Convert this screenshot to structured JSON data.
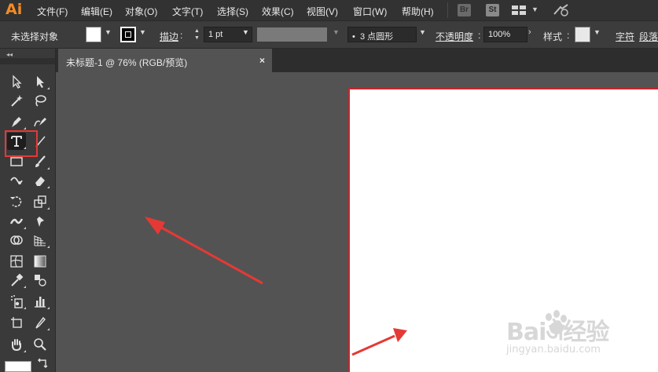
{
  "app": {
    "logo": "Ai"
  },
  "menubar": {
    "items": [
      "文件(F)",
      "编辑(E)",
      "对象(O)",
      "文字(T)",
      "选择(S)",
      "效果(C)",
      "视图(V)",
      "窗口(W)",
      "帮助(H)"
    ],
    "bridge_badge": "Br",
    "stock_badge": "St"
  },
  "controlbar": {
    "selection_status": "未选择对象",
    "stroke_label": "描边",
    "stroke_weight": "1 pt",
    "brush_label": "3 点圆形",
    "brush_bullet": "•",
    "opacity_label": "不透明度",
    "opacity_value": "100%",
    "style_label": "样式",
    "char_label": "字符",
    "para_label": "段落",
    "colon": ":"
  },
  "tab": {
    "title": "未标题-1 @ 76% (RGB/预览)",
    "close": "×"
  },
  "watermark": {
    "brand": "Baiऄ经验",
    "url": "jingyan.baidu.com"
  },
  "colors": {
    "accent": "#f28c25",
    "highlight": "#e53935",
    "arrow": "#e53935",
    "artboard_border": "#c0282d"
  },
  "toolbox": {
    "tools": [
      "selection-tool",
      "direct-selection-tool",
      "magic-wand-tool",
      "lasso-tool",
      "pen-tool",
      "curvature-tool",
      "type-tool",
      "line-segment-tool",
      "rectangle-tool",
      "paintbrush-tool",
      "shaper-tool",
      "eraser-tool",
      "rotate-tool",
      "scale-tool",
      "width-tool",
      "free-transform-tool",
      "shape-builder-tool",
      "perspective-grid-tool",
      "mesh-tool",
      "gradient-tool",
      "eyedropper-tool",
      "blend-tool",
      "symbol-sprayer-tool",
      "column-graph-tool",
      "artboard-tool",
      "slice-tool",
      "hand-tool",
      "zoom-tool"
    ],
    "selected": "type-tool"
  }
}
